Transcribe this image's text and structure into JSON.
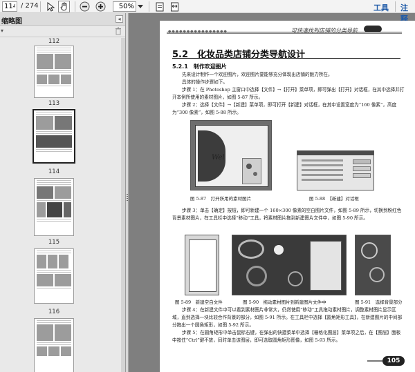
{
  "toolbar": {
    "page_current": "114",
    "page_total": "/ 274",
    "zoom_value": "50%",
    "tools_label": "工具",
    "comment_label": "注释",
    "icons": [
      "select-arrow-icon",
      "hand-tool-icon",
      "zoom-out-icon",
      "zoom-in-icon",
      "dropdown-icon",
      "fit-page-icon",
      "fit-width-icon"
    ]
  },
  "sidebar": {
    "title": "缩略图",
    "pages": [
      {
        "label": "112"
      },
      {
        "label": "113"
      },
      {
        "label": "114",
        "selected": true
      },
      {
        "label": "115"
      },
      {
        "label": "116"
      }
    ]
  },
  "document": {
    "running_header": "可快速找到店铺的分类导航",
    "section_title": "5.2　化妆品类店铺分类导航设计",
    "subsection_title": "5.2.1　制作欢迎图片",
    "paragraphs": [
      "先来设计制作一个欢迎图片，欢迎图片要能够充分体现出店铺的魅力所在。",
      "具体的操作步骤如下。",
      "步骤 1：在 Photoshop 主窗口中选择【文件】→【打开】菜单项，即可弹出【打开】对话框，在其中选择并打开本例所使用的素材图片，如图 5-87 所示。",
      "步骤 2：选择【文件】→【新建】菜单项，即可打开【新建】对话框，在其中设置宽度为“160 像素”，高度为“300 像素”，如图 5-88 所示。",
      "步骤 3：单击【确定】按钮，即可新建一个 160×300 像素的空白图片文件，如图 5-89 所示，切换到粉红色背景素材图片，在工具栏中选择“移动”工具，将素材图片拖到新建图片文件中，如图 5-90 所示。",
      "步骤 4：在新建文件中可以看到素材图片非常大，仍然使用“移动”工具拖动素材图片，调整素材图片显示区域，直到选择一块比较合作背景的部分，如图 5-91 所示。在工具栏中选择【圆角矩形工具】，在新建图片的中间部分拖出一个圆角矩形，如图 5-92 所示。",
      "步骤 5：在圆角矩形中单击鼠标右键，在弹出的快捷菜单中选择【栅格化图层】菜单项之后，在【图层】面板中按住“Ctrl”键不放，同时单击该图层，即可选取圆角矩形图像，如图 5-93 所示。"
    ],
    "captions": {
      "fig87": "图 5-87　打开所用的素材图片",
      "fig88": "图 5-88　【新建】对话框",
      "fig89": "图 5-89　新建空白文件",
      "fig90": "图 5-90　拖动素材图片到新建图片文件中",
      "fig91": "图 5-91　选择背景部分"
    },
    "page_number": "105"
  }
}
